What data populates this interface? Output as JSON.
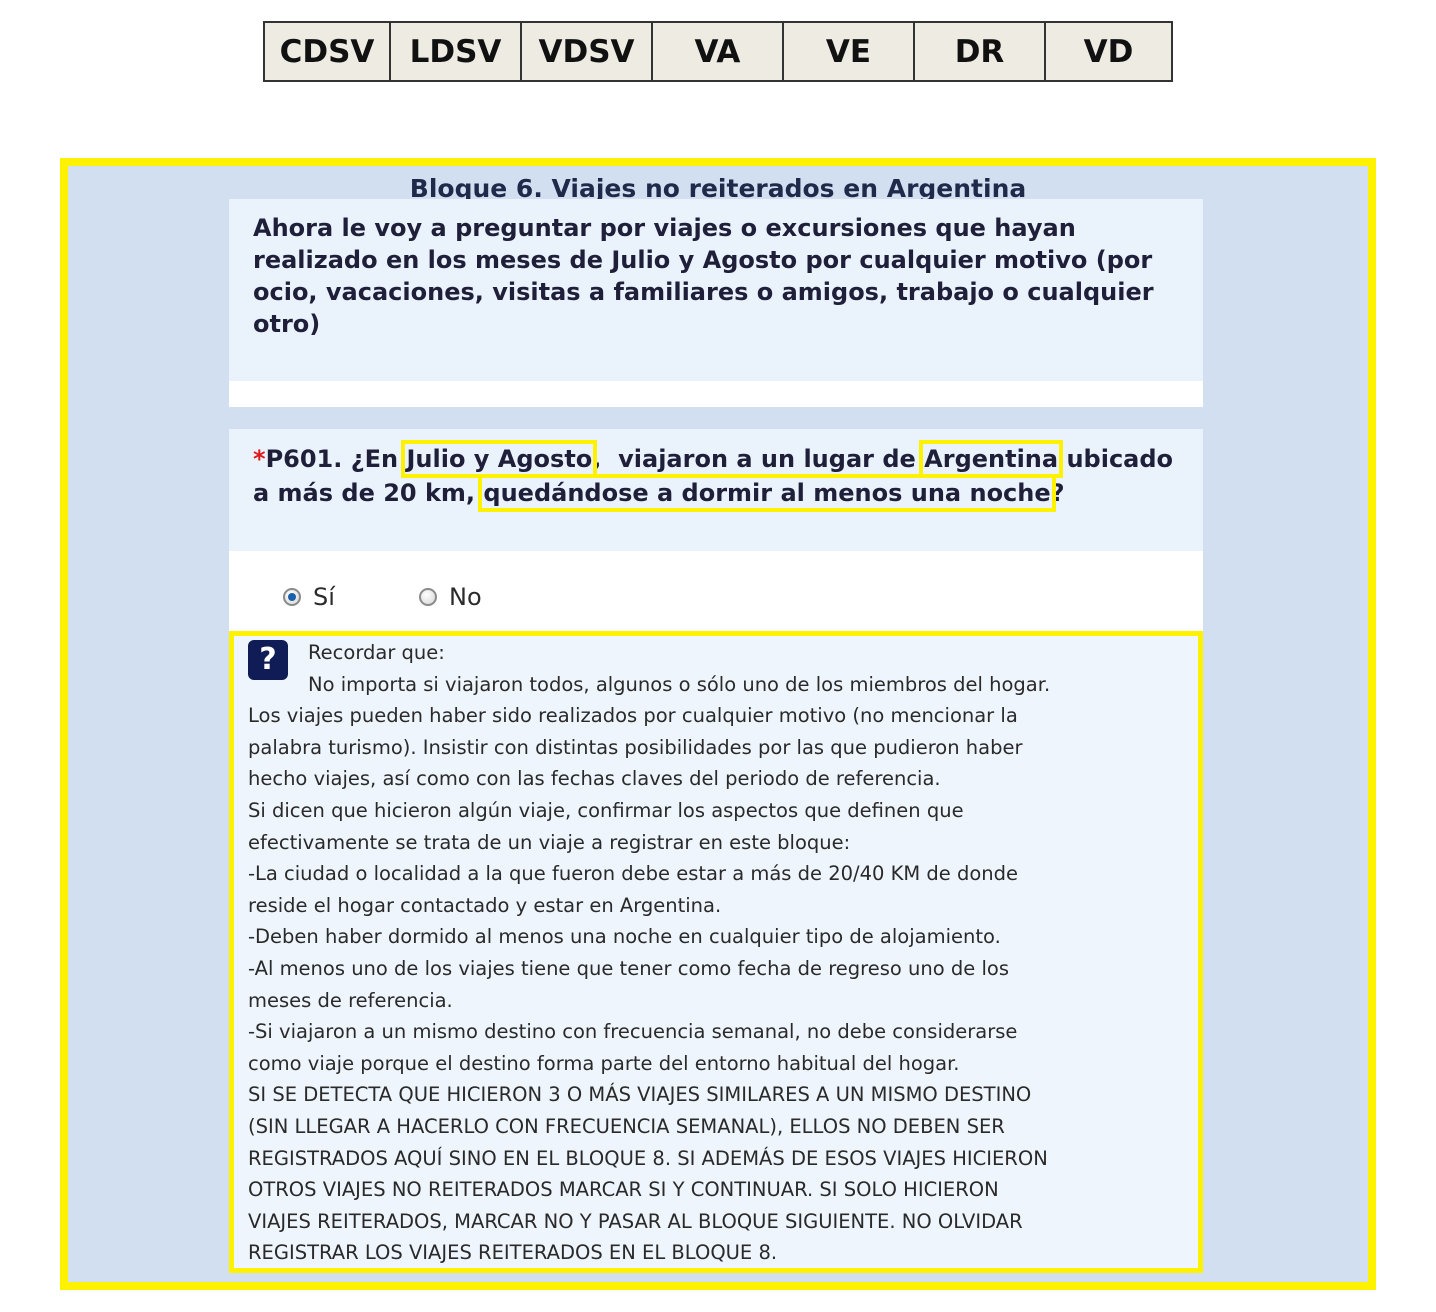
{
  "header_tabs": [
    "CDSV",
    "LDSV",
    "VDSV",
    "VA",
    "VE",
    "DR",
    "VD"
  ],
  "block": {
    "title": "Bloque 6. Viajes no reiterados en Argentina",
    "intro_lines": [
      "Ahora le voy a preguntar por viajes o excursiones que hayan",
      "realizado en los meses de Julio y Agosto por cualquier motivo (por",
      "ocio, vacaciones, visitas a familiares o amigos, trabajo o cualquier",
      "otro)"
    ]
  },
  "question": {
    "required_mark": "*",
    "code": "P601. ¿En ",
    "hl_period": "Julio y Agosto",
    "text_a": ",  viajaron a un lugar de ",
    "hl_place": "Argentina",
    "text_b": " ubicado",
    "text_c": "a más de 20 km, ",
    "hl_condition": "quedándose a dormir al menos una noche",
    "text_d": "?"
  },
  "options": [
    {
      "label": "Sí",
      "selected": true
    },
    {
      "label": "No",
      "selected": false
    }
  ],
  "help": {
    "icon": "question-mark-icon",
    "icon_glyph": "?",
    "lines": [
      "Recordar que:",
      "No importa si viajaron todos, algunos o sólo uno de los miembros del hogar.",
      "Los viajes pueden haber sido realizados por cualquier motivo (no mencionar la",
      "palabra turismo). Insistir con distintas posibilidades por las que pudieron haber",
      "hecho viajes, así como con las fechas claves del periodo de referencia.",
      "Si dicen que hicieron algún viaje, confirmar los aspectos que definen que",
      "efectivamente se trata de un viaje a registrar en este bloque:",
      "-La ciudad o localidad a la que fueron debe estar a más de 20/40 KM de donde",
      "reside el hogar contactado y estar en Argentina.",
      "-Deben haber dormido al menos una noche en cualquier tipo de alojamiento.",
      "-Al menos uno de los viajes tiene que tener como fecha de regreso uno de los",
      "meses de referencia.",
      "-Si viajaron a un mismo destino con frecuencia semanal, no debe considerarse",
      "como viaje porque el destino forma parte del entorno habitual del hogar.",
      "SI SE DETECTA QUE HICIERON 3 O MÁS VIAJES SIMILARES A UN MISMO DESTINO",
      "(SIN LLEGAR A HACERLO CON FRECUENCIA SEMANAL), ELLOS NO DEBEN SER",
      "REGISTRADOS AQUÍ SINO EN EL BLOQUE 8. SI ADEMÁS DE ESOS VIAJES HICIERON",
      "OTROS VIAJES NO REITERADOS MARCAR SI Y CONTINUAR. SI SOLO HICIERON",
      "VIAJES REITERADOS, MARCAR NO Y PASAR AL BLOQUE SIGUIENTE. NO OLVIDAR",
      "REGISTRAR LOS VIAJES REITERADOS EN EL BLOQUE 8."
    ]
  },
  "colors": {
    "highlight": "#fff200",
    "frame_bg": "#d1dff0",
    "panel_bg": "#eaf3fc",
    "required": "#e0181b",
    "help_icon_bg": "#0f1c55"
  }
}
